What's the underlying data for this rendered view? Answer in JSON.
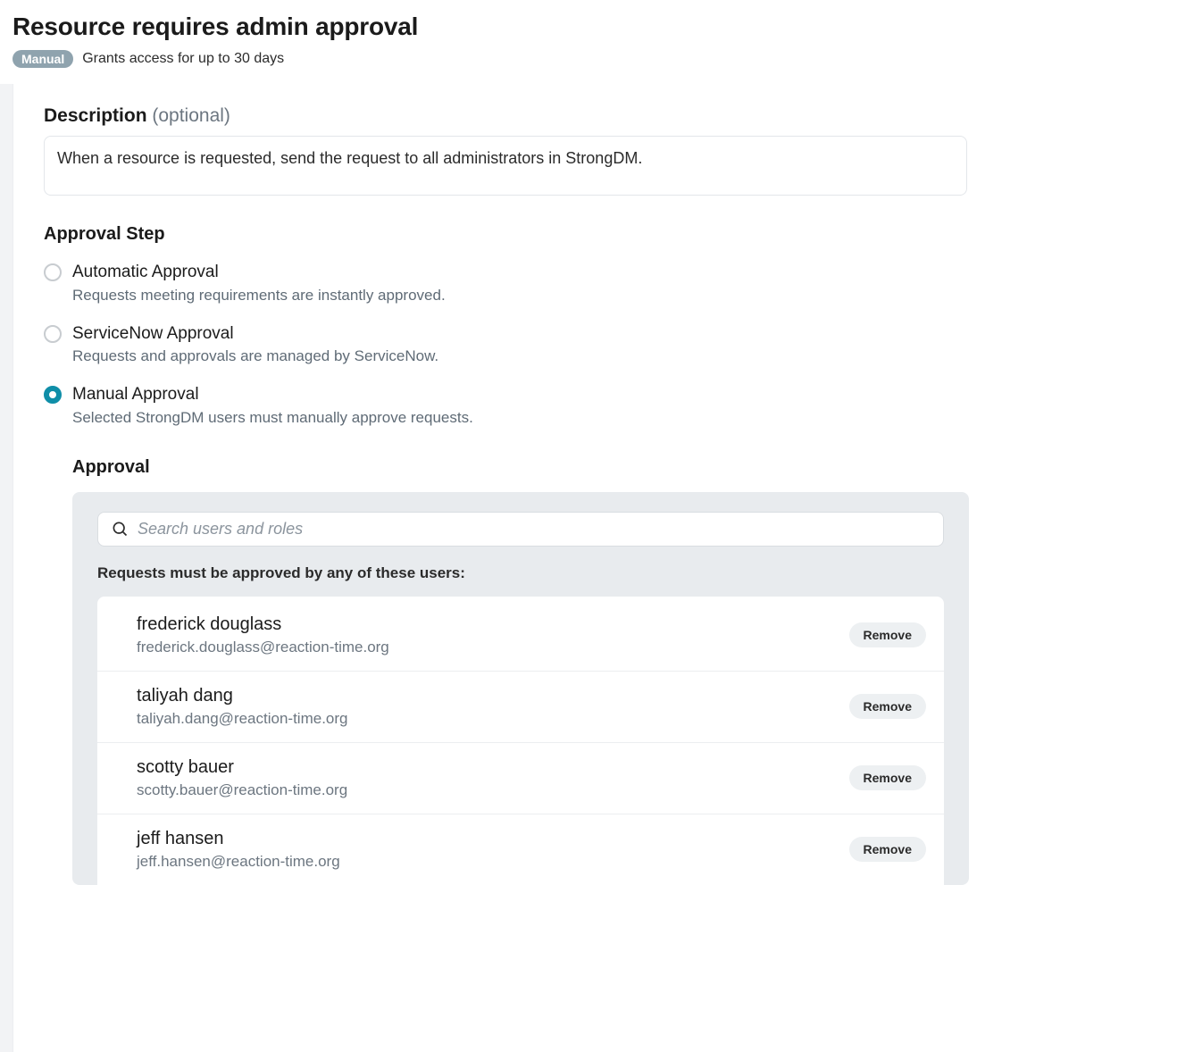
{
  "header": {
    "title": "Resource requires admin approval",
    "badge": "Manual",
    "grants_text": "Grants access for up to 30 days"
  },
  "description": {
    "label": "Description",
    "optional": "(optional)",
    "value": "When a resource is requested, send the request to all administrators in StrongDM."
  },
  "approval_step": {
    "title": "Approval Step",
    "options": [
      {
        "title": "Automatic Approval",
        "desc": "Requests meeting requirements are instantly approved.",
        "selected": false
      },
      {
        "title": "ServiceNow Approval",
        "desc": "Requests and approvals are managed by ServiceNow.",
        "selected": false
      },
      {
        "title": "Manual Approval",
        "desc": "Selected StrongDM users must manually approve requests.",
        "selected": true
      }
    ]
  },
  "approval": {
    "title": "Approval",
    "search_placeholder": "Search users and roles",
    "list_label": "Requests must be approved by any of these users:",
    "remove_label": "Remove",
    "users": [
      {
        "name": "frederick douglass",
        "email": "frederick.douglass@reaction-time.org"
      },
      {
        "name": "taliyah dang",
        "email": "taliyah.dang@reaction-time.org"
      },
      {
        "name": "scotty bauer",
        "email": "scotty.bauer@reaction-time.org"
      },
      {
        "name": "jeff hansen",
        "email": "jeff.hansen@reaction-time.org"
      }
    ]
  }
}
